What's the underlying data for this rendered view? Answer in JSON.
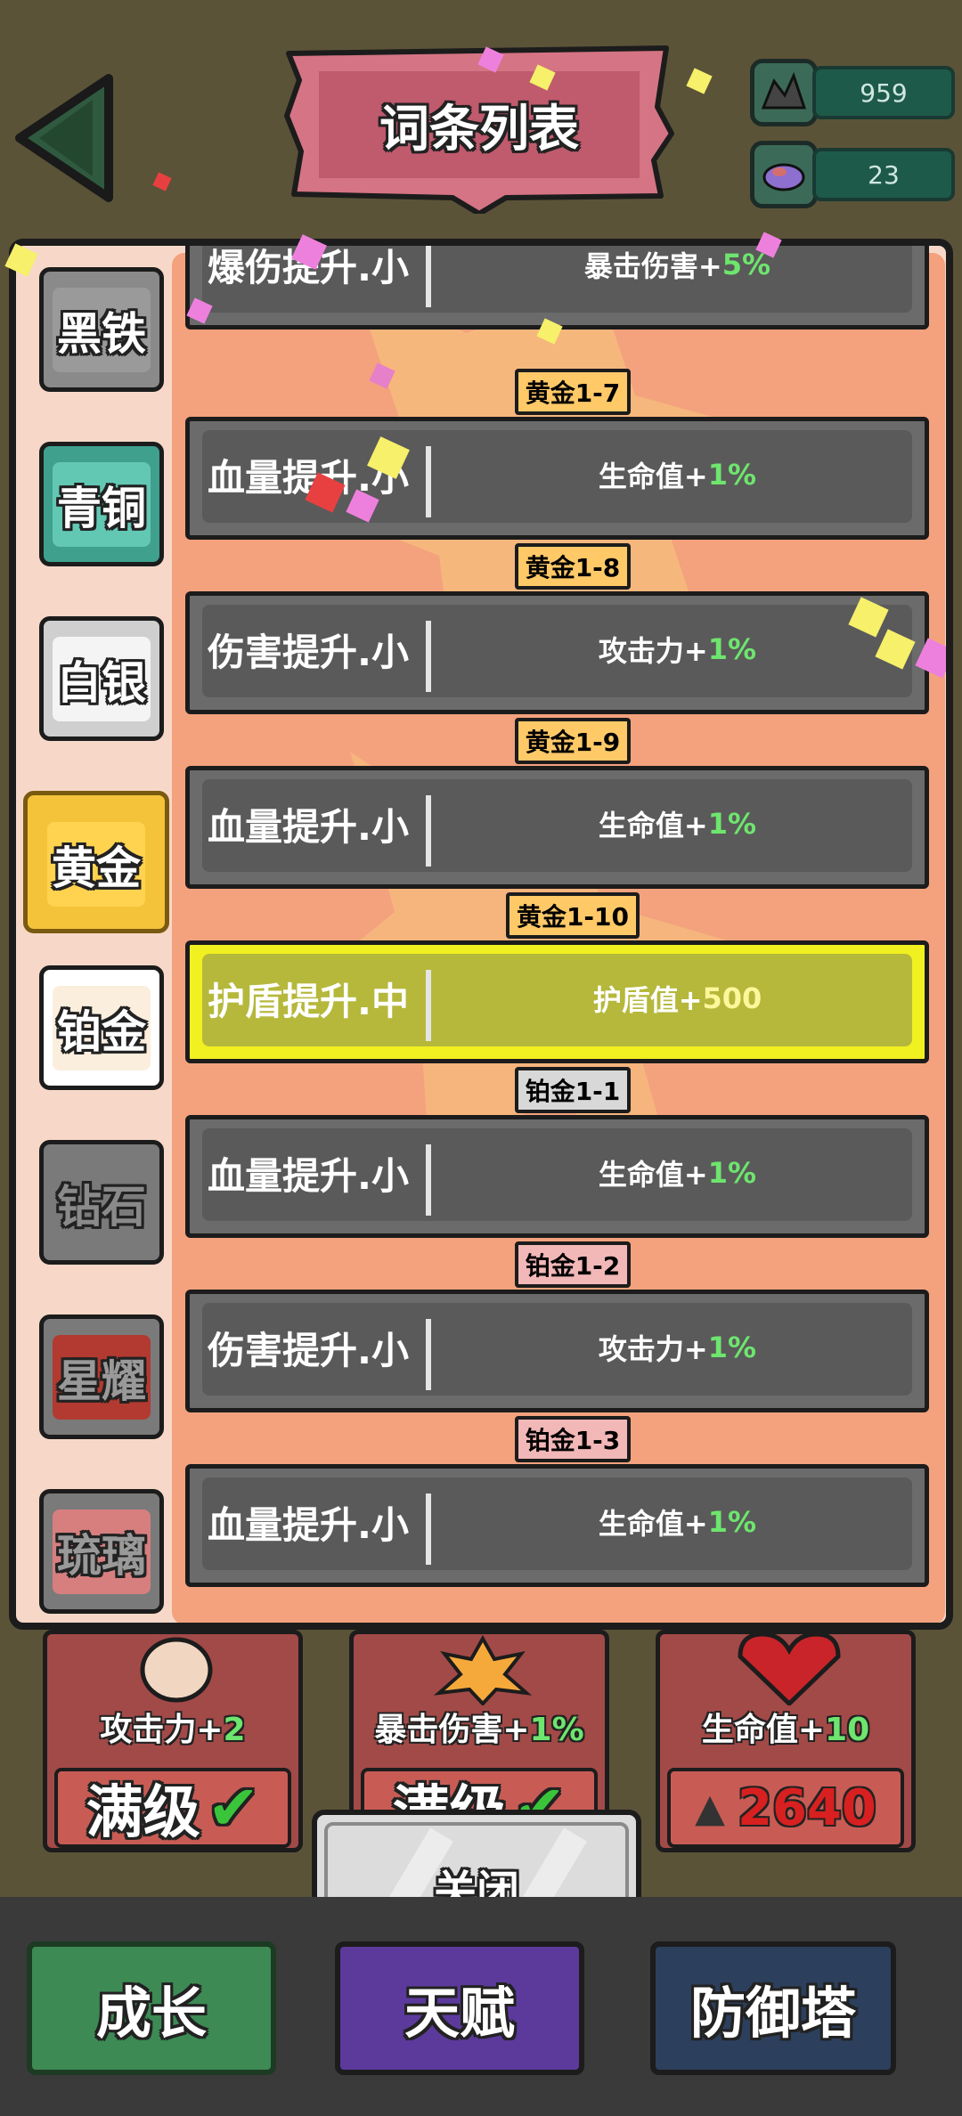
{
  "header": {
    "title": "词条列表",
    "resources": [
      {
        "icon": "ore-icon",
        "value": "959"
      },
      {
        "icon": "gem-icon",
        "value": "23"
      }
    ]
  },
  "sidebar": {
    "tiers": [
      {
        "label": "黑铁",
        "color": "#9a9a9a"
      },
      {
        "label": "青铜",
        "color": "#62c8b4"
      },
      {
        "label": "白银",
        "color": "#f4f4f4"
      },
      {
        "label": "黄金",
        "color": "#ffd34f",
        "selected": true
      },
      {
        "label": "铂金",
        "color": "#fbeedd"
      },
      {
        "label": "钻石",
        "color": "#7a7a7a"
      },
      {
        "label": "星耀",
        "color": "#b23a30"
      },
      {
        "label": "琉璃",
        "color": "#d77f7f"
      }
    ]
  },
  "entries": [
    {
      "name": "爆伤提升.小",
      "effect_label": "暴击伤害+",
      "effect_value": "5%"
    },
    {
      "name": "血量提升.小",
      "effect_label": "生命值+",
      "effect_value": "1%"
    },
    {
      "name": "伤害提升.小",
      "effect_label": "攻击力+",
      "effect_value": "1%"
    },
    {
      "name": "血量提升.小",
      "effect_label": "生命值+",
      "effect_value": "1%"
    },
    {
      "name": "护盾提升.中",
      "effect_label": "护盾值+",
      "effect_value": "500"
    },
    {
      "name": "血量提升.小",
      "effect_label": "生命值+",
      "effect_value": "1%"
    },
    {
      "name": "伤害提升.小",
      "effect_label": "攻击力+",
      "effect_value": "1%"
    },
    {
      "name": "血量提升.小",
      "effect_label": "生命值+",
      "effect_value": "1%"
    }
  ],
  "level_tags": [
    "黄金1-7",
    "黄金1-8",
    "黄金1-9",
    "黄金1-10",
    "铂金1-1",
    "铂金1-2",
    "铂金1-3"
  ],
  "cards": [
    {
      "stat_label": "攻击力+",
      "stat_value": "2",
      "status": "满级"
    },
    {
      "stat_label": "暴击伤害+",
      "stat_value": "1%",
      "status": "满级"
    },
    {
      "stat_label": "生命值+",
      "stat_value": "10",
      "cost": "2640"
    }
  ],
  "close_label": "关闭",
  "nav": [
    "成长",
    "天赋",
    "防御塔"
  ],
  "colors": {
    "selected_row": "#f1f020",
    "value_green": "#6ee56e"
  }
}
